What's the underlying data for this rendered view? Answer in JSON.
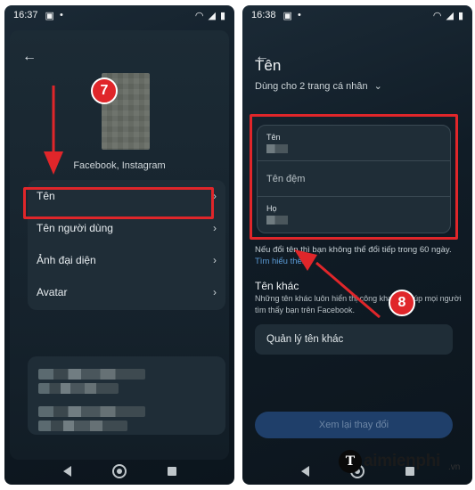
{
  "left": {
    "status_time": "16:37",
    "sub_label": "Facebook, Instagram",
    "menu": [
      {
        "label": "Tên"
      },
      {
        "label": "Tên người dùng"
      },
      {
        "label": "Ảnh đại diện"
      },
      {
        "label": "Avatar"
      }
    ],
    "step_number": "7"
  },
  "right": {
    "status_time": "16:38",
    "title": "Tên",
    "subtitle": "Dùng cho 2 trang cá nhân",
    "fields": {
      "first_label": "Tên",
      "middle_placeholder": "Tên đệm",
      "last_label": "Họ"
    },
    "note_text": "Nếu đổi tên thì bạn không thể đổi tiếp trong 60 ngày.",
    "note_link": "Tìm hiểu thêm",
    "other_names_heading": "Tên khác",
    "other_names_desc": "Những tên khác luôn hiển thị công khai để giúp mọi người tìm thấy bạn trên Facebook.",
    "manage_label": "Quản lý tên khác",
    "review_button": "Xem lại thay đổi",
    "step_number": "8"
  },
  "branding": {
    "logo_letter": "T",
    "name": "aimienphi",
    "suffix": ".vn"
  },
  "colors": {
    "highlight": "#e0262a",
    "link": "#5b9bd6"
  }
}
